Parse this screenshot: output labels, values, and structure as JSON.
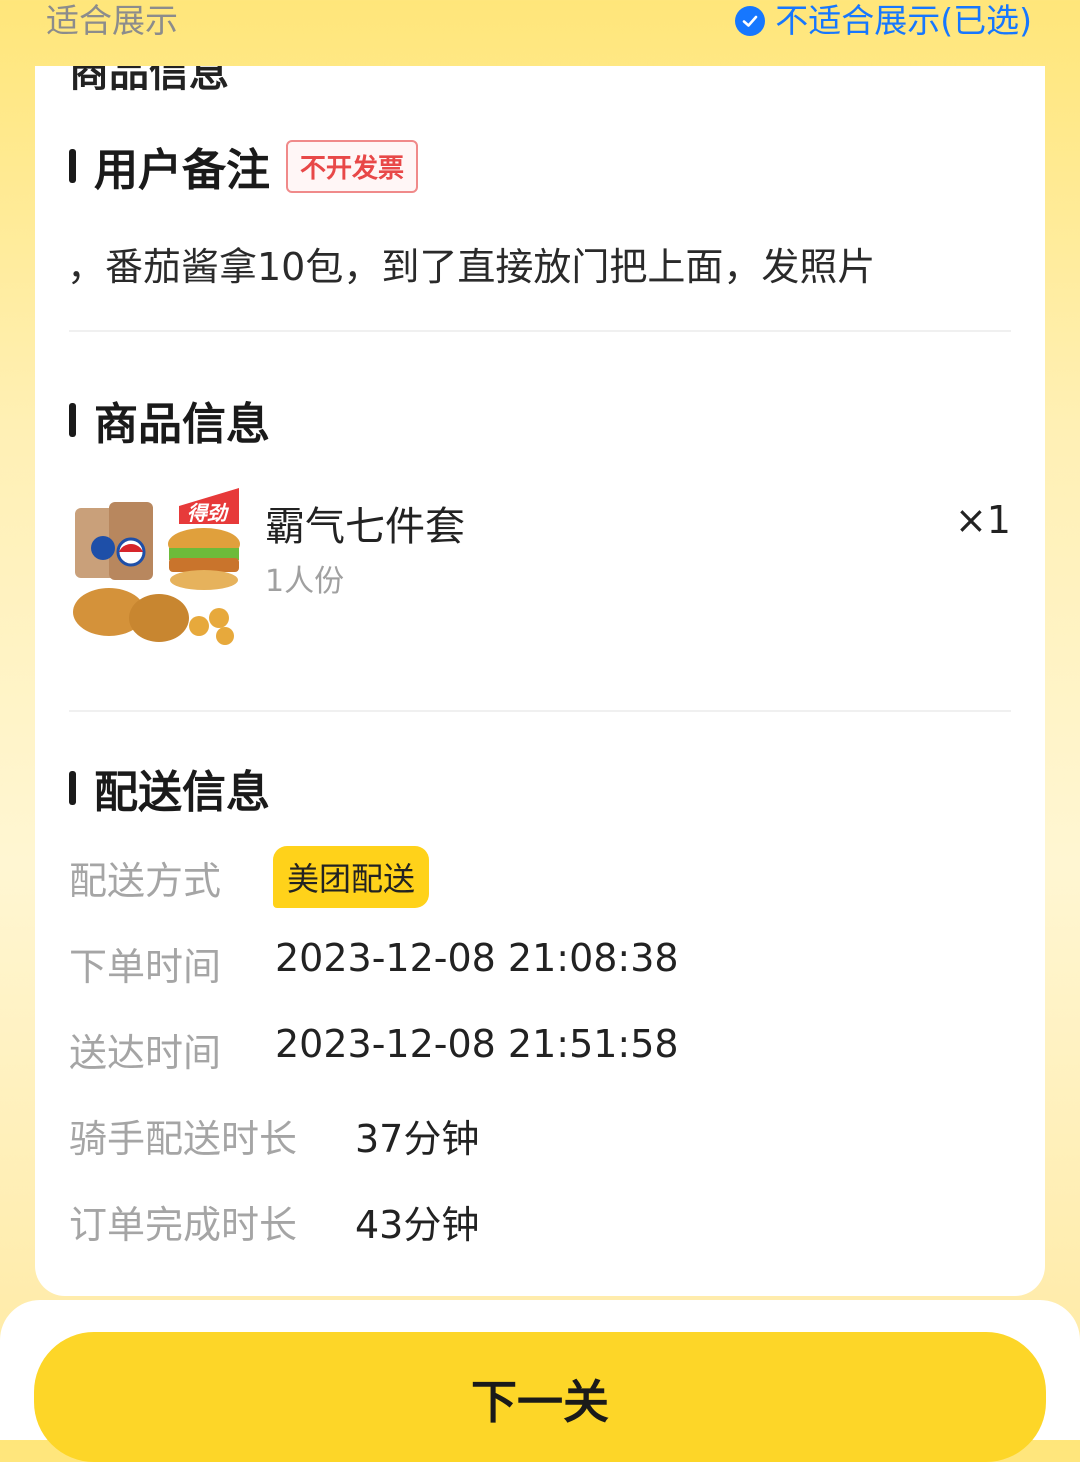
{
  "top_options": {
    "suitable": "适合展示",
    "not_suitable": "不适合展示(已选)",
    "check_icon": "check-circle-icon"
  },
  "cut_off_heading": "商品信息",
  "user_note": {
    "title": "用户备注",
    "tag": "不开发票",
    "text": "，番茄酱拿10包，到了直接放门把上面，发照片"
  },
  "product_info": {
    "title": "商品信息",
    "items": [
      {
        "name": "霸气七件套",
        "sub": "1人份",
        "qty": "×1",
        "image": "kfc-meal-image"
      }
    ]
  },
  "delivery_info": {
    "title": "配送信息",
    "rows": [
      {
        "label": "配送方式",
        "value": "美团配送"
      },
      {
        "label": "下单时间",
        "value": "2023-12-08 21:08:38"
      },
      {
        "label": "送达时间",
        "value": "2023-12-08 21:51:58"
      },
      {
        "label": "骑手配送时长",
        "value": "37分钟"
      },
      {
        "label": "订单完成时长",
        "value": "43分钟"
      }
    ]
  },
  "next_button": "下一关",
  "colors": {
    "accent_yellow": "#ffd21a",
    "link_blue": "#1677ff",
    "tag_red": "#e84848"
  }
}
